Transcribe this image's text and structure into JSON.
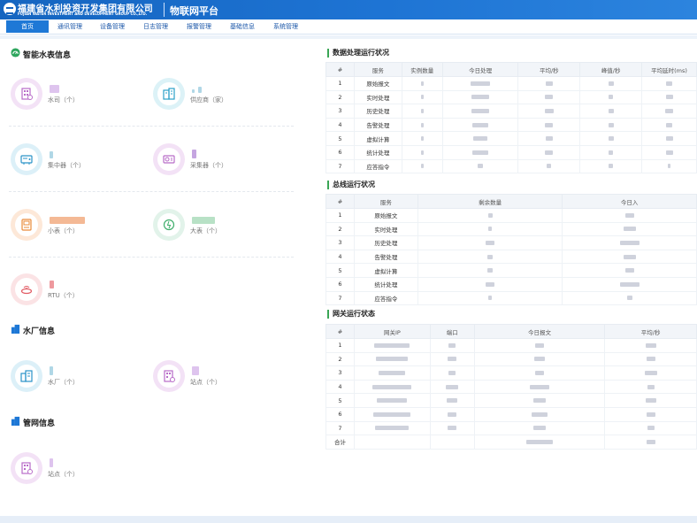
{
  "header": {
    "org_cn": "福建省水利投资开发集团有限公司",
    "org_en": "FUJIAN WATER INVESTMENT AND DEVELOPMENT GROUP CO.,LTD.",
    "platform": "物联网平台"
  },
  "nav": [
    "首页",
    "通讯管理",
    "设备管理",
    "日志管理",
    "报警管理",
    "基础信息",
    "系统管理"
  ],
  "active_nav": "首页",
  "meter": {
    "title": "智能水表信息",
    "cards": [
      {
        "icon": "building-icon",
        "label": "水司（个）",
        "color": "#ead0ef"
      },
      {
        "icon": "office-icon",
        "label": "供应商（家）",
        "color": "#c9ecf3"
      },
      {
        "icon": "concentrator-icon",
        "label": "集中器（个）",
        "color": "#c9e7f3"
      },
      {
        "icon": "collector-icon",
        "label": "采集器（个）",
        "color": "#ead0ef"
      },
      {
        "icon": "small-meter-icon",
        "label": "小表（个）",
        "color": "#fbe0cc"
      },
      {
        "icon": "large-meter-icon",
        "label": "大表（个）",
        "color": "#d4ede0"
      },
      {
        "icon": "rtu-icon",
        "label": "RTU（个）",
        "color": "#f7d4d6"
      }
    ]
  },
  "plant": {
    "title": "水厂信息",
    "cards": [
      {
        "icon": "plant-icon",
        "label": "水厂（个）",
        "color": "#c9e7f3"
      },
      {
        "icon": "station-icon",
        "label": "站点（个）",
        "color": "#ead0ef"
      }
    ]
  },
  "pipe": {
    "title": "管网信息",
    "cards": [
      {
        "icon": "station-icon",
        "label": "站点（个）",
        "color": "#ead0ef"
      }
    ]
  },
  "data_processing": {
    "title": "数据处理运行状况",
    "columns": [
      "#",
      "服务",
      "实例数量",
      "今日处理",
      "平均/秒",
      "峰值/秒",
      "平均延时(ms)"
    ],
    "rows": [
      {
        "no": "1",
        "service": "原始报文"
      },
      {
        "no": "2",
        "service": "实时处理"
      },
      {
        "no": "3",
        "service": "历史处理"
      },
      {
        "no": "4",
        "service": "告警处理"
      },
      {
        "no": "5",
        "service": "虚拟计算"
      },
      {
        "no": "6",
        "service": "统计处理"
      },
      {
        "no": "7",
        "service": "应答指令"
      }
    ]
  },
  "bus": {
    "title": "总线运行状况",
    "columns": [
      "#",
      "服务",
      "剩余数量",
      "今日入"
    ],
    "rows": [
      {
        "no": "1",
        "service": "原始报文"
      },
      {
        "no": "2",
        "service": "实时处理"
      },
      {
        "no": "3",
        "service": "历史处理"
      },
      {
        "no": "4",
        "service": "告警处理"
      },
      {
        "no": "5",
        "service": "虚拟计算"
      },
      {
        "no": "6",
        "service": "统计处理"
      },
      {
        "no": "7",
        "service": "应答指令"
      }
    ]
  },
  "gateway": {
    "title": "网关运行状态",
    "columns": [
      "#",
      "网关IP",
      "端口",
      "今日报文",
      "平均/秒"
    ],
    "rows": [
      {
        "no": "1"
      },
      {
        "no": "2"
      },
      {
        "no": "3"
      },
      {
        "no": "4"
      },
      {
        "no": "5"
      },
      {
        "no": "6"
      },
      {
        "no": "7"
      }
    ],
    "total_label": "合计"
  }
}
